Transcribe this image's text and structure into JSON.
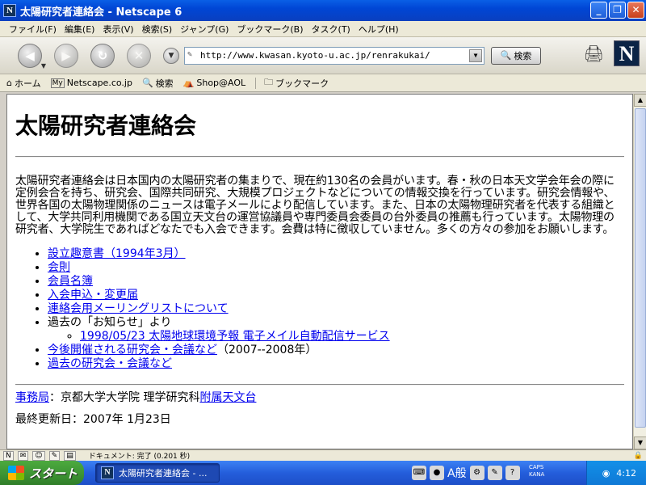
{
  "window": {
    "title": "太陽研究者連絡会 - Netscape 6",
    "app_icon": "N"
  },
  "menu": [
    "ファイル(F)",
    "編集(E)",
    "表示(V)",
    "検索(S)",
    "ジャンプ(G)",
    "ブックマーク(B)",
    "タスク(T)",
    "ヘルプ(H)"
  ],
  "nav": {
    "url": "http://www.kwasan.kyoto-u.ac.jp/renrakukai/",
    "search_label": "検索"
  },
  "personal_toolbar": {
    "home": "ホーム",
    "mynetscape": "Netscape.co.jp",
    "search": "検索",
    "shop": "Shop@AOL",
    "bookmarks": "ブックマーク"
  },
  "page": {
    "heading": "太陽研究者連絡会",
    "intro": "太陽研究者連絡会は日本国内の太陽研究者の集まりで、現在約130名の会員がいます。春・秋の日本天文学会年会の際に定例会合を持ち、研究会、国際共同研究、大規模プロジェクトなどについての情報交換を行っています。研究会情報や、世界各国の太陽物理関係のニュースは電子メールにより配信しています。また、日本の太陽物理研究者を代表する組織として、大学共同利用機関である国立天文台の運営協議員や専門委員会委員の台外委員の推薦も行っています。太陽物理の研究者、大学院生であればどなたでも入会できます。会費は特に徴収していません。多くの方々の参加をお願いします。",
    "links": {
      "founding": "設立趣意書（1994年3月）",
      "rules": "会則",
      "members": "会員名簿",
      "join": "入会申込・変更届",
      "mailing": "連絡会用メーリングリストについて",
      "past_notice_label": "過去の「お知らせ」より",
      "notice_sub": "1998/05/23 太陽地球環境予報 電子メイル自動配信サービス",
      "future_meetings": "今後開催される研究会・会議など",
      "future_meetings_note": "（2007--2008年）",
      "past_meetings": "過去の研究会・会議など"
    },
    "footer": {
      "office_link": "事務局",
      "office_text": "：京都大学大学院 理学研究科",
      "observatory_link": "附属天文台",
      "last_modified": "最終更新日：2007年 1月23日"
    }
  },
  "status": {
    "text": "ドキュメント: 完了 (0.201 秒)"
  },
  "taskbar": {
    "start_label": "スタート",
    "task_label": "太陽研究者連絡会 - ...",
    "ime_label": "A般",
    "caps_label": "CAPS",
    "kana_label": "KANA",
    "clock": "4:12"
  },
  "colors": {
    "link": "#0000ee",
    "titlebar": "#0046d5",
    "taskbar": "#245edb",
    "start": "#3d9434"
  }
}
